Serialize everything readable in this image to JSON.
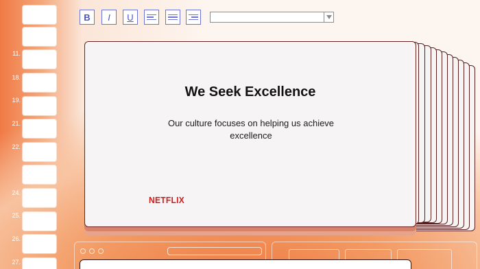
{
  "filmstrip": {
    "slide_numbers": [
      "11.",
      "18.",
      "19.",
      "21.",
      "22.",
      "24.",
      "25.",
      "26.",
      "27."
    ]
  },
  "toolbar": {
    "bold_label": "B",
    "italic_label": "I",
    "underline_label": "U",
    "align_left_icon": "align-left-icon",
    "align_center_icon": "align-center-icon",
    "align_right_icon": "align-right-icon",
    "dropdown_value": ""
  },
  "slide": {
    "title": "We Seek Excellence",
    "body": "Our culture focuses on helping us achieve excellence",
    "logo_text": "NETFLIX"
  },
  "colors": {
    "accent": "#6b72d8",
    "slide_border": "#6a2222",
    "logo_red": "#d21c1c",
    "background_orange": "#f07a45"
  }
}
